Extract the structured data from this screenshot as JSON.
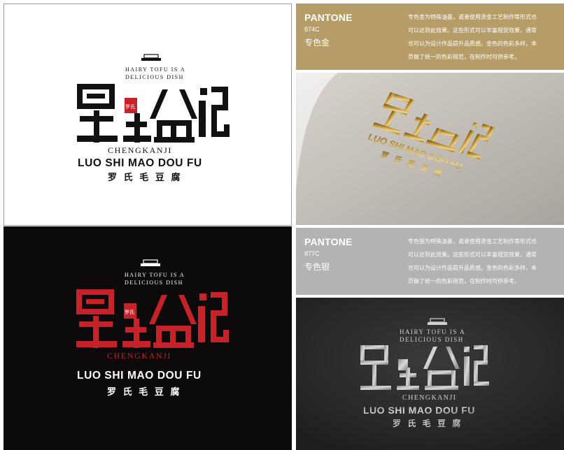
{
  "logo": {
    "tagline_line1": "HAIRY TOFU IS A",
    "tagline_line2": "DELICIOUS DISH",
    "chinese_mark": "罗氏毛豆腐记",
    "seal_text": "罗氏",
    "sub_brand": "CHENGKANJI",
    "name_pinyin": "LUO SHI MAO DOU FU",
    "name_chinese": "罗 氏 毛 豆 腐"
  },
  "gold_swatch": {
    "brand": "PANTONE",
    "code": "874C",
    "name": "专色金",
    "desc_lines": [
      "专色金为特殊油墨，或者使用烫金工艺制作等形式也",
      "可以达到此效果。这些形式可以丰富视觉效果，通常",
      "也可以为设计作品提升品质感。金色的色彩多样，本",
      "页做了统一的色彩规范，在制作时可供参考。"
    ]
  },
  "silver_swatch": {
    "brand": "PANTONE",
    "code": "877C",
    "name": "专色银",
    "desc_lines": [
      "专色银为特殊油墨，或者使用烫金工艺制作等形式也",
      "可以达到此效果。这些形式可以丰富视觉效果，通常",
      "也可以为设计作品提升品质感。金色的色彩多样，本",
      "页做了统一的色彩规范，在制作时可供参考。"
    ]
  },
  "colors": {
    "logo_black": "#111111",
    "logo_red": "#c5222a",
    "gold": "#b69d67",
    "silver": "#b3b3b3",
    "dark_bg": "#0c0a0b"
  }
}
